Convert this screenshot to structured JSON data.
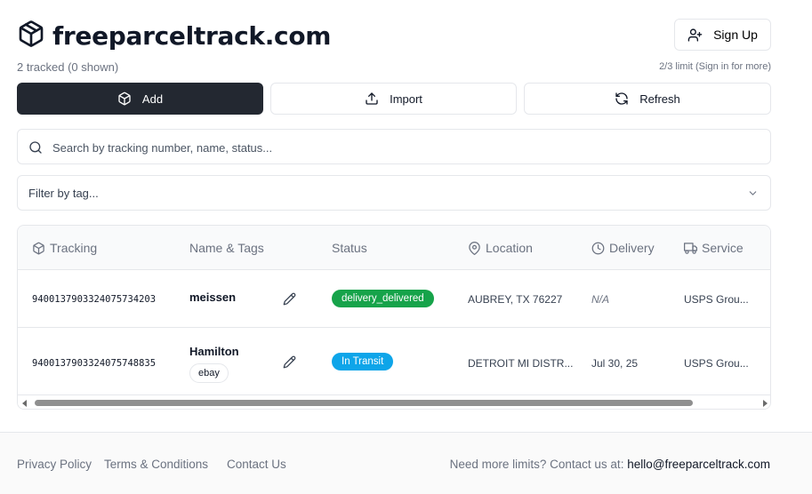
{
  "app": {
    "title": "freeparceltrack.com",
    "tracked_summary": "2 tracked (0 shown)",
    "limit_note": "2/3 limit (Sign in for more)",
    "sign_up_label": "Sign Up"
  },
  "actions": {
    "add_label": "Add",
    "import_label": "Import",
    "refresh_label": "Refresh"
  },
  "search": {
    "placeholder": "Search by tracking number, name, status..."
  },
  "filter": {
    "placeholder": "Filter by tag..."
  },
  "table": {
    "columns": [
      "Tracking",
      "Name & Tags",
      "Status",
      "Location",
      "Delivery",
      "Service"
    ],
    "rows": [
      {
        "tracking": "9400137903324075734203",
        "name": "meissen",
        "tags": [],
        "status": "delivery_delivered",
        "status_color": "#16a34a",
        "location": "AUBREY, TX 76227",
        "delivery": "N/A",
        "service": "USPS Grou..."
      },
      {
        "tracking": "9400137903324075748835",
        "name": "Hamilton",
        "tags": [
          "ebay"
        ],
        "status": "In Transit",
        "status_color": "#0ea5e9",
        "location": "DETROIT MI DISTR...",
        "delivery": "Jul 30, 25",
        "service": "USPS Grou..."
      }
    ]
  },
  "footer": {
    "privacy": "Privacy Policy",
    "terms": "Terms & Conditions",
    "contact": "Contact Us",
    "more_limits_text": "Need more limits? Contact us at:",
    "email": "hello@freeparceltrack.com"
  },
  "icons": {
    "logo": "package-icon",
    "sign_up": "user-plus-icon",
    "add": "package-icon",
    "import": "upload-icon",
    "refresh": "refresh-icon",
    "search": "search-icon",
    "filter": "chevron-down-icon",
    "tracking": "package-icon",
    "location": "map-pin-icon",
    "delivery": "clock-icon",
    "service": "truck-icon",
    "edit": "pencil-icon"
  }
}
